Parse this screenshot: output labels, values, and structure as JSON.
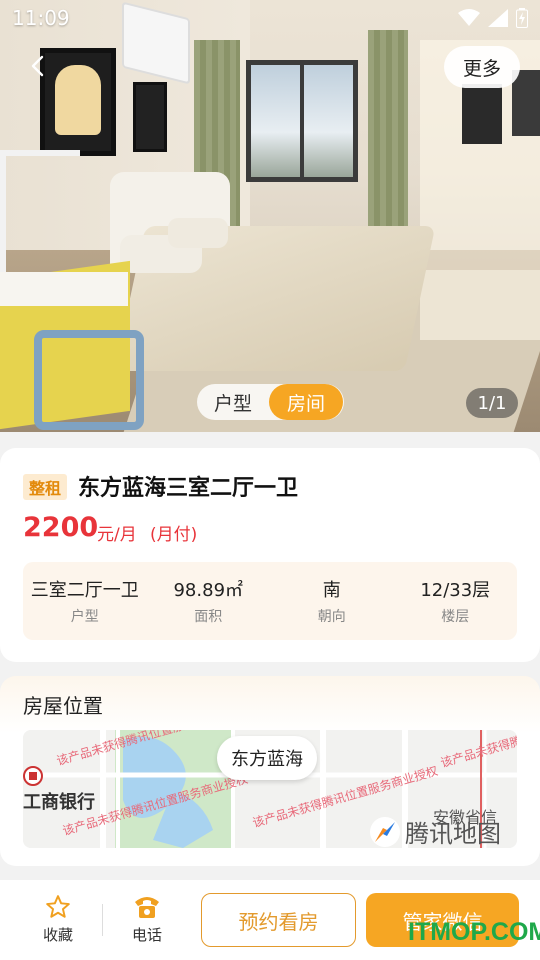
{
  "status_bar": {
    "time": "11:09"
  },
  "hero": {
    "more_label": "更多",
    "tabs": [
      {
        "label": "户型",
        "active": false
      },
      {
        "label": "房间",
        "active": true
      }
    ],
    "counter": "1/1"
  },
  "listing": {
    "badge": "整租",
    "title": "东方蓝海三室二厅一卫",
    "price": "2200",
    "price_unit": "元/月",
    "payment": "(月付)",
    "specs": [
      {
        "value": "三室二厅一卫",
        "label": "户型"
      },
      {
        "value": "98.89㎡",
        "label": "面积"
      },
      {
        "value": "南",
        "label": "朝向"
      },
      {
        "value": "12/33层",
        "label": "楼层"
      }
    ]
  },
  "location": {
    "title": "房屋位置",
    "pin_label": "东方蓝海",
    "bank_label": "工商银行",
    "map_text_right": "安徽省信",
    "map_logo": "腾讯地图",
    "watermark": "该产品未获得腾讯位置服务商业授权"
  },
  "bottom_bar": {
    "favorite_label": "收藏",
    "phone_label": "电话",
    "book_label": "预约看房",
    "wechat_label": "管家微信"
  },
  "site_watermark": "ITMOP.COM",
  "colors": {
    "accent": "#f6a623",
    "price": "#e8343a",
    "badge_bg": "#fdebd0"
  }
}
